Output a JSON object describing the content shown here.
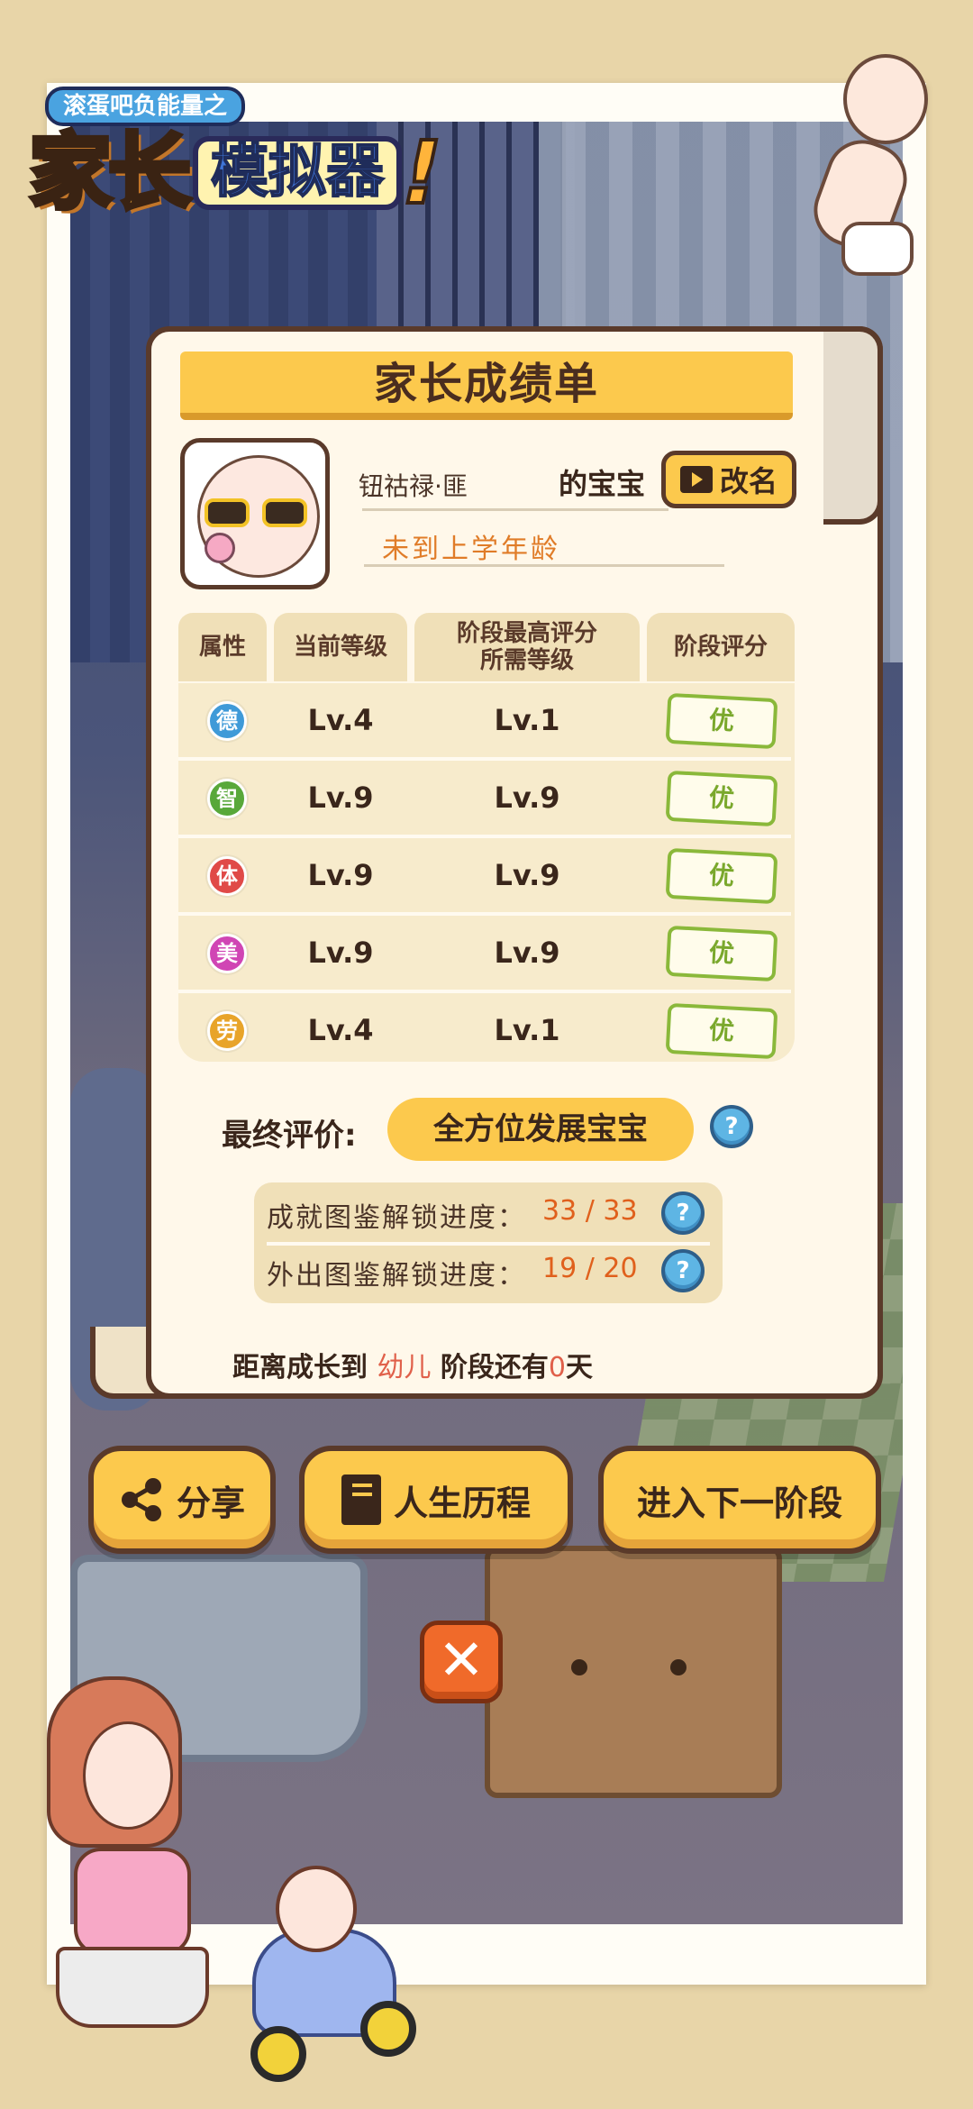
{
  "logo": {
    "top_text": "滚蛋吧负能量之",
    "main_left": "家长",
    "main_right": "模拟器",
    "exclaim": "!"
  },
  "report": {
    "title": "家长成绩单",
    "baby_name": "钮祜禄·匪",
    "name_suffix": "的宝宝",
    "rename_label": "改名",
    "status": "未到上学年龄"
  },
  "table": {
    "headers": [
      "属性",
      "当前等级",
      "阶段最高评分\n所需等级",
      "阶段评分"
    ],
    "header_col3_line1": "阶段最高评分",
    "header_col3_line2": "所需等级",
    "rows": [
      {
        "attr": "德",
        "color": "#3f9ad8",
        "current": "Lv.4",
        "required": "Lv.1",
        "grade": "优"
      },
      {
        "attr": "智",
        "color": "#58a83a",
        "current": "Lv.9",
        "required": "Lv.9",
        "grade": "优"
      },
      {
        "attr": "体",
        "color": "#e04a48",
        "current": "Lv.9",
        "required": "Lv.9",
        "grade": "优"
      },
      {
        "attr": "美",
        "color": "#d045b4",
        "current": "Lv.9",
        "required": "Lv.9",
        "grade": "优"
      },
      {
        "attr": "劳",
        "color": "#e8a42a",
        "current": "Lv.4",
        "required": "Lv.1",
        "grade": "优"
      }
    ]
  },
  "final": {
    "label": "最终评价:",
    "value": "全方位发展宝宝"
  },
  "progress": {
    "achievement_label": "成就图鉴解锁进度：",
    "achievement_value": "33 / 33",
    "outing_label": "外出图鉴解锁进度：",
    "outing_value": "19 / 20"
  },
  "countdown": {
    "prefix": "距离成长到",
    "stage": "幼儿",
    "middle": "阶段还有",
    "days": "0",
    "suffix": "天"
  },
  "buttons": {
    "share": "分享",
    "history": "人生历程",
    "next_stage": "进入下一阶段"
  },
  "icons": {
    "help": "?",
    "close": "✕"
  },
  "colors": {
    "accent_yellow": "#fcc94d",
    "outline_brown": "#5a3a2a",
    "close_orange": "#f06a2a",
    "grade_green": "#8ab83a",
    "progress_orange": "#e0601c"
  }
}
